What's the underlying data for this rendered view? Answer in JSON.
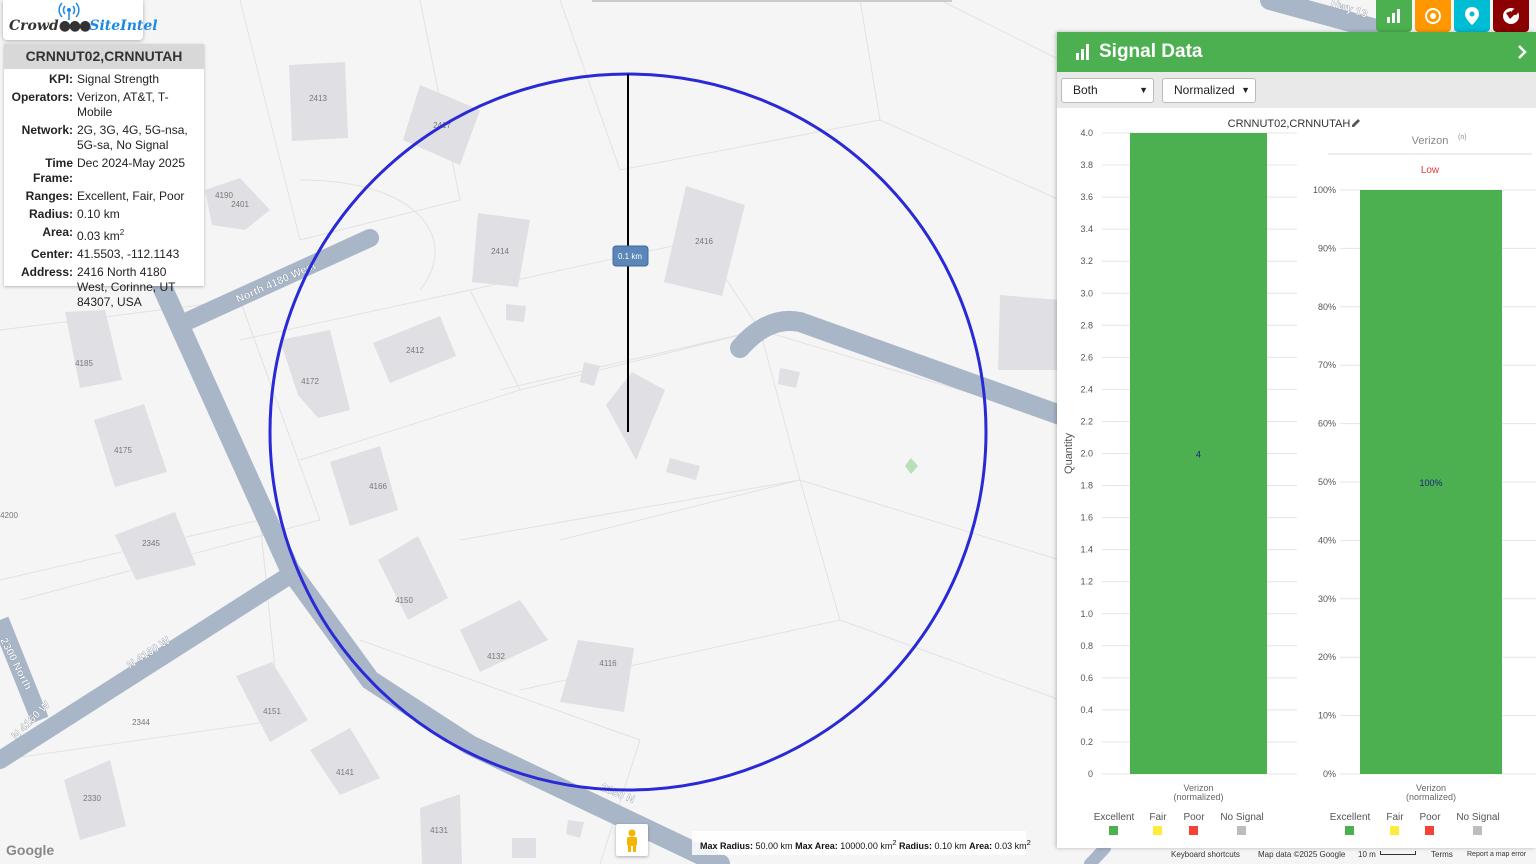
{
  "logo": {
    "prefix": "Crowd",
    "suffix": "SiteIntel"
  },
  "info_card": {
    "title": "CRNNUT02,CRNNUTAH",
    "rows": [
      {
        "key": "KPI:",
        "value": "Signal Strength"
      },
      {
        "key": "Operators:",
        "value": "Verizon, AT&T, T-Mobile"
      },
      {
        "key": "Network:",
        "value": "2G, 3G, 4G, 5G-nsa, 5G-sa, No Signal"
      },
      {
        "key": "Time Frame:",
        "value": "Dec 2024-May 2025"
      },
      {
        "key": "Ranges:",
        "value": "Excellent, Fair, Poor"
      },
      {
        "key": "Radius:",
        "value": "0.10 km"
      },
      {
        "key": "Area:",
        "value": "0.03 km",
        "sup": "2"
      },
      {
        "key": "Center:",
        "value": "41.5503, -112.1143"
      },
      {
        "key": "Address:",
        "value": "2416 North 4180 West, Corinne, UT 84307, USA"
      }
    ]
  },
  "top_buttons": [
    {
      "name": "signal-chart-button",
      "icon": "bar-chart-icon",
      "color": "#4caf50"
    },
    {
      "name": "location-target-button",
      "icon": "target-icon",
      "color": "#ff9800"
    },
    {
      "name": "map-pin-button",
      "icon": "map-pin-icon",
      "color": "#00bcd4"
    },
    {
      "name": "globe-pin-button",
      "icon": "globe-pin-icon",
      "color": "#8b0000"
    }
  ],
  "map": {
    "streets": [
      "North 4180 West",
      "N 4160 W",
      "N 4160 W",
      "2300 North",
      "2350 N",
      "Hwy 13"
    ],
    "buildings": [
      "2413",
      "2417",
      "4190",
      "2401",
      "2414",
      "2416",
      "4185",
      "4172",
      "2412",
      "4175",
      "4166",
      "4200",
      "2345",
      "4150",
      "4132",
      "4116",
      "2344",
      "4151",
      "4141",
      "2330",
      "4131"
    ],
    "radius_label": "0.1 km",
    "circle_color": "#2929d6"
  },
  "panel": {
    "title": "Signal Data",
    "select_both": "Both",
    "select_mode": "Normalized",
    "chart_title": "CRNNUT02,CRNNUTAH",
    "accent": "#4caf50"
  },
  "chart_data": [
    {
      "type": "bar",
      "title": "CRNNUT02,CRNNUTAH",
      "ylabel": "Quantity",
      "ylim": [
        0,
        4
      ],
      "yticks": [
        "0",
        "0.2",
        "0.4",
        "0.6",
        "0.8",
        "1.0",
        "1.2",
        "1.4",
        "1.6",
        "1.8",
        "2.0",
        "2.2",
        "2.4",
        "2.6",
        "2.8",
        "3.0",
        "3.2",
        "3.4",
        "3.6",
        "3.8",
        "4.0"
      ],
      "categories": [
        "Verizon (normalized)"
      ],
      "category_lines": [
        "Verizon",
        "(normalized)"
      ],
      "values": [
        4
      ],
      "data_labels": [
        "4"
      ],
      "legend": [
        {
          "label": "Excellent",
          "color": "#4caf50"
        },
        {
          "label": "Fair",
          "color": "#ffeb3b"
        },
        {
          "label": "Poor",
          "color": "#f44336"
        },
        {
          "label": "No Signal",
          "color": "#bdbdbd"
        }
      ]
    },
    {
      "type": "bar",
      "title": "Verizon",
      "title_sup": "(n)",
      "subtitle": "Low",
      "ylim": [
        0,
        100
      ],
      "yticks": [
        "0%",
        "10%",
        "20%",
        "30%",
        "40%",
        "50%",
        "60%",
        "70%",
        "80%",
        "90%",
        "100%"
      ],
      "categories": [
        "Verizon (normalized)"
      ],
      "category_lines": [
        "Verizon",
        "(normalized)"
      ],
      "values": [
        100
      ],
      "data_labels": [
        "100%"
      ],
      "legend": [
        {
          "label": "Excellent",
          "color": "#4caf50"
        },
        {
          "label": "Fair",
          "color": "#ffeb3b"
        },
        {
          "label": "Poor",
          "color": "#f44336"
        },
        {
          "label": "No Signal",
          "color": "#bdbdbd"
        }
      ]
    }
  ],
  "bottom_info": {
    "max_radius_label": "Max Radius:",
    "max_radius": "50.00 km",
    "max_area_label": "Max Area:",
    "max_area": "10000.00 km",
    "radius_label": "Radius:",
    "radius": "0.10 km",
    "area_label": "Area:",
    "area": "0.03 km",
    "sup": "2"
  },
  "footer": {
    "google": "Google",
    "shortcuts": "Keyboard shortcuts",
    "map_data": "Map data ©2025 Google",
    "scale": "10 m",
    "terms": "Terms",
    "report": "Report a map error"
  }
}
